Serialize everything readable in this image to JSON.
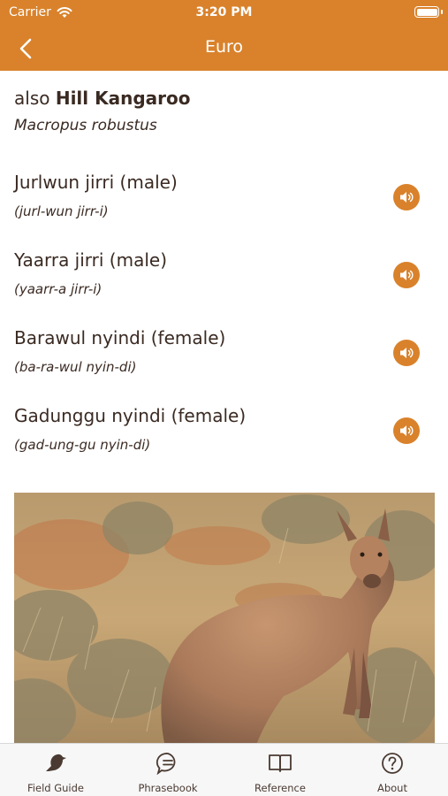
{
  "status_bar": {
    "carrier": "Carrier",
    "time": "3:20 PM"
  },
  "nav": {
    "title": "Euro",
    "back_icon": "chevron-left-icon"
  },
  "species": {
    "also_prefix": "also",
    "common_name": "Hill Kangaroo",
    "scientific_name": "Macropus robustus"
  },
  "words": [
    {
      "name": "Jurlwun jirri (male)",
      "pronunciation": "(jurl-wun jirr-i)",
      "icon": "speaker-icon"
    },
    {
      "name": "Yaarra jirri (male)",
      "pronunciation": "(yaarr-a jirr-i)",
      "icon": "speaker-icon"
    },
    {
      "name": "Barawul nyindi (female)",
      "pronunciation": "(ba-ra-wul nyin-di)",
      "icon": "speaker-icon"
    },
    {
      "name": "Gadunggu nyindi (female)",
      "pronunciation": "(gad-ung-gu nyin-di)",
      "icon": "speaker-icon"
    }
  ],
  "tabs": [
    {
      "label": "Field Guide",
      "icon": "bird-icon"
    },
    {
      "label": "Phrasebook",
      "icon": "speech-bubble-icon"
    },
    {
      "label": "Reference",
      "icon": "book-icon"
    },
    {
      "label": "About",
      "icon": "question-icon"
    }
  ],
  "colors": {
    "accent": "#d9822b",
    "text": "#3a2a22",
    "tabbar_bg": "#f7f7f7"
  }
}
